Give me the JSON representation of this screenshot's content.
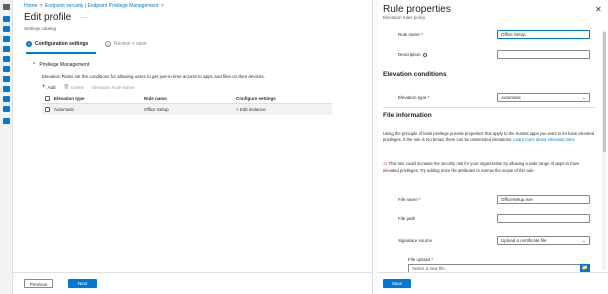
{
  "rail": {
    "icons": [
      {
        "name": "portal-menu-icon",
        "color": "#605e5c"
      },
      {
        "name": "home-icon",
        "color": "#0078d4"
      },
      {
        "name": "dashboard-icon",
        "color": "#0078d4"
      },
      {
        "name": "all-services-icon",
        "color": "#0078d4"
      },
      {
        "name": "devices-icon",
        "color": "#0078d4"
      },
      {
        "name": "apps-icon",
        "color": "#0078d4"
      },
      {
        "name": "endpoint-security-icon",
        "color": "#0078d4"
      },
      {
        "name": "reports-icon",
        "color": "#0078d4"
      },
      {
        "name": "users-icon",
        "color": "#0078d4"
      },
      {
        "name": "groups-icon",
        "color": "#0078d4"
      },
      {
        "name": "tenant-admin-icon",
        "color": "#0078d4"
      },
      {
        "name": "troubleshooting-icon",
        "color": "#0078d4"
      }
    ]
  },
  "breadcrumb": {
    "home": "Home",
    "sep1": ">",
    "endpoint_security": "Endpoint security | Endpoint Privilege Management",
    "sep2": ">"
  },
  "header": {
    "title": "Edit profile",
    "more": "...",
    "subtitle": "Settings catalog"
  },
  "steps": [
    {
      "num": "1",
      "label": "Configuration settings",
      "active": true
    },
    {
      "num": "2",
      "label": "Review + save",
      "active": false
    }
  ],
  "section": {
    "chevron": "^",
    "title": "Privilege Management",
    "description": "Elevation Rules set the conditions for allowing users to get just-in-time access to apps and files on their devices."
  },
  "toolbar": {
    "add_icon": "+",
    "add": "Add",
    "delete_icon": "🗑",
    "delete": "Delete",
    "filter": "Elevation Rule Name"
  },
  "grid": {
    "headers": [
      "Elevation type",
      "Rule name",
      "Configure settings"
    ],
    "rows": [
      {
        "type": "Automatic",
        "name": "Office Setup",
        "settings": "+ Edit instance"
      }
    ]
  },
  "footer_left": {
    "previous": "Previous",
    "next": "Next"
  },
  "panel": {
    "title": "Rule properties",
    "subtitle": "Elevation rules policy",
    "close": "✕",
    "rule_name_label": "Rule name *",
    "rule_name_value": "Office Setup",
    "description_label": "Description",
    "description_value": "",
    "elevation_conditions_heading": "Elevation conditions",
    "elevation_type_label": "Elevation type *",
    "elevation_type_value": "Automatic",
    "file_info_heading": "File information",
    "file_info_para": "Using the principle of least privilege provide properties that apply to the trusted apps you want to let have elevated privileges. If the rule is too broad, there can be unintended elevations.",
    "file_info_link": "Learn more about elevation rules",
    "warn_icon": "⚠",
    "warn_para": "This rule could increase the security risk for your organization by allowing a wide range of apps to have elevated privileges. Try adding more file attributes to narrow the scope of this rule.",
    "file_name_label": "File name *",
    "file_name_value": "OfficeSetup.exe",
    "file_path_label": "File path",
    "file_path_value": "",
    "signature_source_label": "Signature source",
    "signature_source_value": "Upload a certificate file",
    "file_upload_label": "File upload *",
    "file_upload_placeholder": "Select a new file",
    "upload_icon": "📁",
    "dropdown_icon": "⌄",
    "save": "Save"
  },
  "colors": {
    "accent": "#0078d4",
    "warning": "#d83b01"
  }
}
